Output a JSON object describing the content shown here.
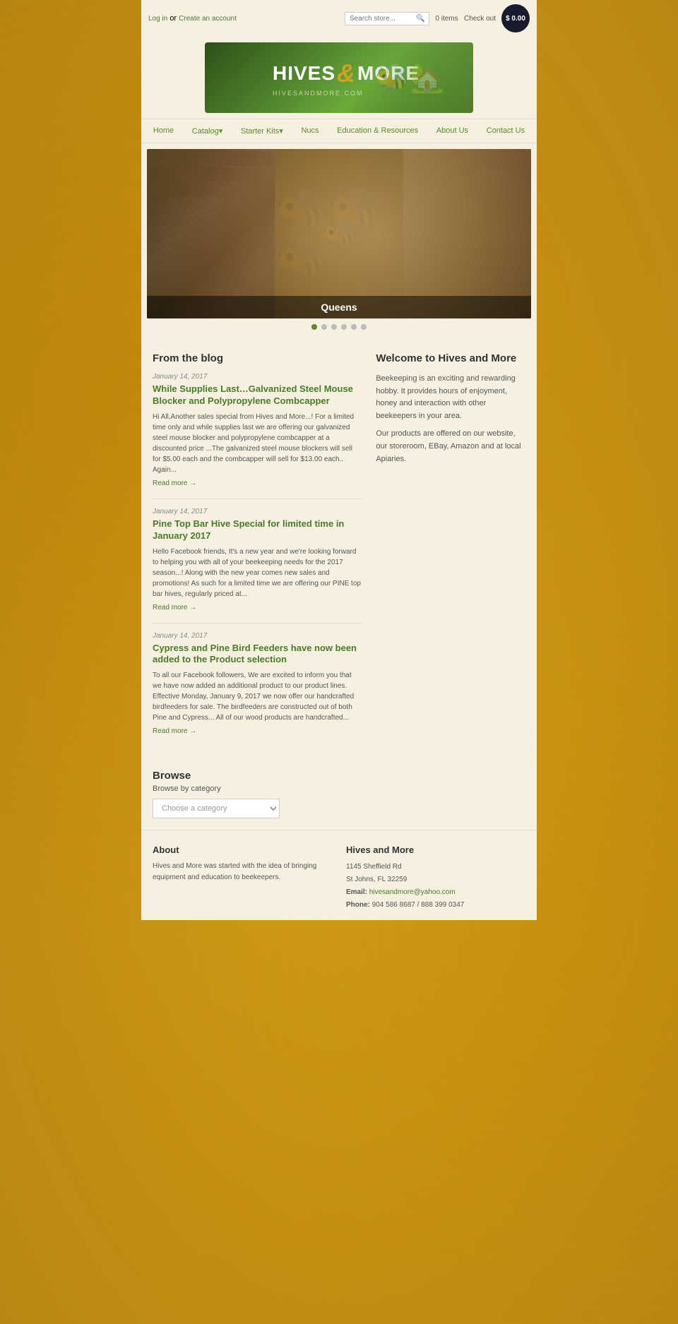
{
  "site": {
    "name": "Hives and More",
    "domain": "HIVESANDMORE.COM"
  },
  "topbar": {
    "login_text": "Log in",
    "or_text": " or ",
    "create_text": "Create an account",
    "search_placeholder": "Search store...",
    "cart_items": "0 items",
    "checkout": "Check out",
    "cart_total": "$ 0.00"
  },
  "nav": {
    "items": [
      {
        "label": "Home",
        "has_dropdown": false
      },
      {
        "label": "Catalog",
        "has_dropdown": true
      },
      {
        "label": "Starter Kits",
        "has_dropdown": true
      },
      {
        "label": "Nucs",
        "has_dropdown": false
      },
      {
        "label": "Education & Resources",
        "has_dropdown": false
      },
      {
        "label": "About Us",
        "has_dropdown": false
      },
      {
        "label": "Contact Us",
        "has_dropdown": false
      }
    ]
  },
  "slider": {
    "caption": "Queens",
    "dots": [
      {
        "active": true
      },
      {
        "active": false
      },
      {
        "active": false
      },
      {
        "active": false
      },
      {
        "active": false
      },
      {
        "active": false
      }
    ]
  },
  "blog": {
    "title": "From the blog",
    "posts": [
      {
        "date": "January 14, 2017",
        "title": "While Supplies Last…Galvanized Steel Mouse Blocker and Polypropylene Combcapper",
        "excerpt": "Hi All,Another sales special from Hives and More...! For a limited time only and while supplies last we are offering our galvanized steel mouse blocker and polypropylene combcapper at a discounted price ...The galvanized steel mouse blockers will sell for $5.00 each and the combcapper will sell for $13.00 each.. Again...",
        "read_more": "Read more →"
      },
      {
        "date": "January 14, 2017",
        "title": "Pine Top Bar Hive Special for limited time in January 2017",
        "excerpt": "Hello Facebook friends, It's a new year and we're looking forward to helping you with all of your beekeeping needs for the 2017 season...! Along with the new year comes new sales and promotions! As such for a limited time we are offering our PINE top bar hives, regularly priced at...",
        "read_more": "Read more →"
      },
      {
        "date": "January 14, 2017",
        "title": "Cypress and Pine Bird Feeders have now been added to the Product selection",
        "excerpt": "To all our Facebook followers, We are excited to inform you that we have now added an additional product to our product lines. Effective Monday, January 9, 2017 we now offer our handcrafted birdfeeders for sale. The birdfeeders are constructed out of both Pine and Cypress... All of our wood products are handcrafted...",
        "read_more": "Read more →"
      }
    ]
  },
  "welcome": {
    "title": "Welcome to Hives and More",
    "text1": "Beekeeping is an exciting and rewarding hobby. It provides hours of enjoyment, honey and interaction with other beekeepers in your area.",
    "text2": "Our products are offered on our website, our storeroom, EBay, Amazon and at local Apiaries."
  },
  "browse": {
    "title": "Browse",
    "subtitle": "Browse by category",
    "select_placeholder": "Choose a category"
  },
  "footer": {
    "about": {
      "title": "About",
      "text": "Hives and More was started with the idea of bringing equipment and education to beekeepers."
    },
    "contact": {
      "title": "Hives and More",
      "address_line1": "1145 Sheffield Rd",
      "address_line2": "St Johns, FL 32259",
      "email_label": "Email:",
      "email": "hivesandmore@yahoo.com",
      "phone_label": "Phone:",
      "phone": "904 586 8687 / 888 399 0347"
    }
  }
}
